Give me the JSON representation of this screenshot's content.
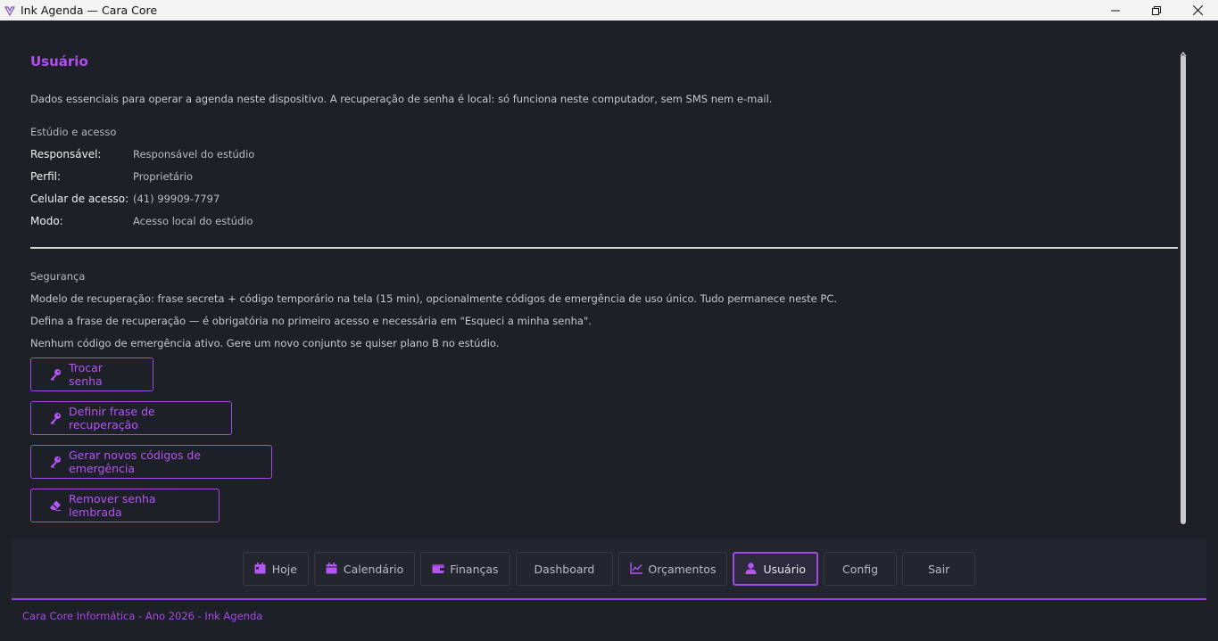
{
  "window": {
    "title": "Ink Agenda — Cara Core"
  },
  "page": {
    "heading": "Usuário",
    "description": "Dados essenciais para operar a agenda neste dispositivo. A recuperação de senha é local: só funciona neste computador, sem SMS nem e-mail."
  },
  "studio": {
    "label": "Estúdio e acesso",
    "rows": [
      {
        "key": "Responsável:",
        "value": "Responsável do estúdio"
      },
      {
        "key": "Perfil:",
        "value": "Proprietário"
      },
      {
        "key": "Celular de acesso:",
        "value": "(41) 99909-7797"
      },
      {
        "key": "Modo:",
        "value": "Acesso local do estúdio"
      }
    ]
  },
  "security": {
    "label": "Segurança",
    "lines": [
      "Modelo de recuperação: frase secreta + código temporário na tela (15 min), opcionalmente códigos de emergência de uso único. Tudo permanece neste PC.",
      "Defina a frase de recuperação — é obrigatória no primeiro acesso e necessária em \"Esqueci a minha senha\".",
      "Nenhum código de emergência ativo. Gere um novo conjunto se quiser plano B no estúdio."
    ],
    "buttons": [
      {
        "label": "Trocar senha",
        "icon": "key-icon"
      },
      {
        "label": "Definir frase de recuperação",
        "icon": "key-icon"
      },
      {
        "label": "Gerar novos códigos de emergência",
        "icon": "key-icon"
      },
      {
        "label": "Remover senha lembrada",
        "icon": "eraser-icon"
      }
    ]
  },
  "nav": {
    "items": [
      {
        "label": "Hoje",
        "icon": "calendar-icon"
      },
      {
        "label": "Calendário",
        "icon": "calendar-icon"
      },
      {
        "label": "Finanças",
        "icon": "wallet-icon"
      },
      {
        "label": "Dashboard",
        "icon": ""
      },
      {
        "label": "Orçamentos",
        "icon": "chart-line-icon"
      },
      {
        "label": "Usuário",
        "icon": "user-icon",
        "active": true
      },
      {
        "label": "Config",
        "icon": ""
      },
      {
        "label": "Sair",
        "icon": ""
      }
    ]
  },
  "footer": {
    "text": "Cara Core Informática - Ano 2026 - Ink Agenda"
  },
  "colors": {
    "accent": "#b14ff0",
    "background": "#1d2027",
    "navbar": "#23262e"
  }
}
